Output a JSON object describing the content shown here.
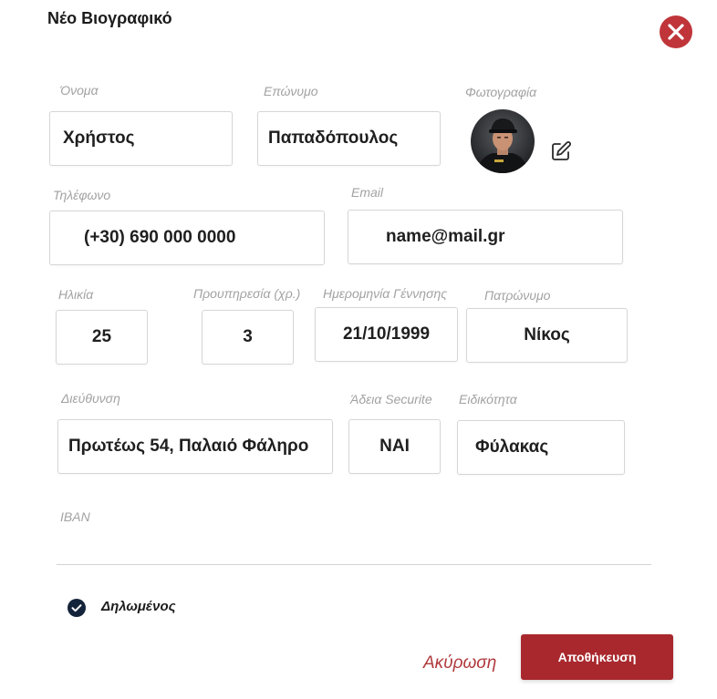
{
  "dialog": {
    "title": "Νέο Βιογραφικό"
  },
  "fields": {
    "first_name": {
      "label": "Όνομα",
      "value": "Χρήστος"
    },
    "last_name": {
      "label": "Επώνυμο",
      "value": "Παπαδόπουλος"
    },
    "photo": {
      "label": "Φωτογραφία"
    },
    "phone": {
      "label": "Τηλέφωνο",
      "value": "(+30) 690 000 0000"
    },
    "email": {
      "label": "Email",
      "value": "name@mail.gr"
    },
    "age": {
      "label": "Ηλικία",
      "value": "25"
    },
    "experience": {
      "label": "Προυπηρεσία (χρ.)",
      "value": "3"
    },
    "birth_date": {
      "label": "Ημερομηνία Γέννησης",
      "value": "21/10/1999"
    },
    "father_name": {
      "label": "Πατρώνυμο",
      "value": "Νίκος"
    },
    "address": {
      "label": "Διεύθυνση",
      "value": "Πρωτέως 54, Παλαιό Φάληρο"
    },
    "securite_license": {
      "label": "Άδεια Securite",
      "value": "ΝΑΙ"
    },
    "specialty": {
      "label": "Ειδικότητα",
      "value": "Φύλακας"
    },
    "iban": {
      "label": "IBAN",
      "value": ""
    }
  },
  "declared": {
    "label": "Δηλωμένος",
    "checked": true
  },
  "actions": {
    "cancel_label": "Ακύρωση",
    "save_label": "Αποθήκευση"
  },
  "colors": {
    "accent": "#a8282d",
    "close": "#c0353a",
    "checkbox": "#13233a"
  },
  "icons": [
    "close-icon",
    "edit-icon",
    "check-icon"
  ]
}
